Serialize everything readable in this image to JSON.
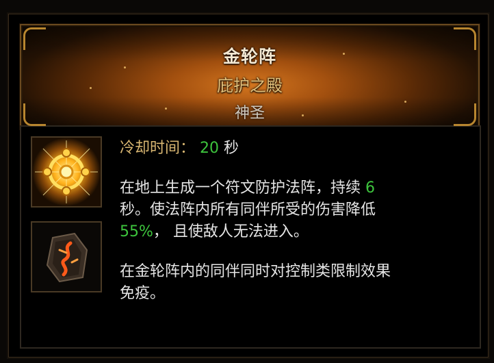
{
  "skill": {
    "name": "金轮阵",
    "rune_name": "庇护之殿",
    "category": "神圣"
  },
  "cooldown": {
    "label": "冷却时间：",
    "value": "20",
    "unit": "秒"
  },
  "description": {
    "line1_pre": "在地上生成一个符文防护法阵，持续 ",
    "duration": "6",
    "line2": "秒。使法阵内所有同伴所受的伤害降低",
    "reduction": "55%",
    "line3_post": "， 且使敌人无法进入。",
    "immunity_line1": "在金轮阵内的同伴同时对控制类限制效果",
    "immunity_line2": "免疫。"
  },
  "icons": {
    "skill_icon": "golden-rune-circle-icon",
    "rune_icon": "red-rune-stone-icon"
  },
  "colors": {
    "title": "#f4e8d2",
    "rune_name": "#e2c07a",
    "category": "#cfc9bf",
    "highlight": "#3dc43d",
    "label": "#d9b772"
  }
}
